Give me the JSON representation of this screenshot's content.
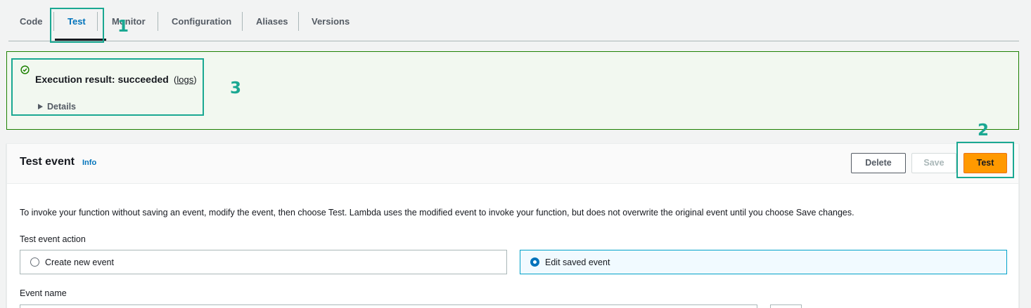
{
  "tabs": [
    {
      "label": "Code"
    },
    {
      "label": "Test"
    },
    {
      "label": "Monitor"
    },
    {
      "label": "Configuration"
    },
    {
      "label": "Aliases"
    },
    {
      "label": "Versions"
    }
  ],
  "result": {
    "title": "Execution result: succeeded",
    "logs_open": "(",
    "logs_link": "logs",
    "logs_close": ")",
    "details_label": "Details",
    "icon": "check-circle-icon",
    "color": "#1d8102"
  },
  "test_event": {
    "title": "Test event",
    "info_label": "Info",
    "buttons": {
      "delete": "Delete",
      "save": "Save",
      "test": "Test"
    },
    "description": "To invoke your function without saving an event, modify the event, then choose Test. Lambda uses the modified event to invoke your function, but does not overwrite the original event until you choose Save changes.",
    "action_label": "Test event action",
    "options": [
      {
        "label": "Create new event",
        "selected": false
      },
      {
        "label": "Edit saved event",
        "selected": true
      }
    ],
    "event_name_label": "Event name"
  },
  "annotations": [
    "1",
    "2",
    "3"
  ],
  "colors": {
    "accent": "#0073bb",
    "primary_button": "#ff9900",
    "annotation": "#1aa892",
    "success": "#1d8102"
  }
}
